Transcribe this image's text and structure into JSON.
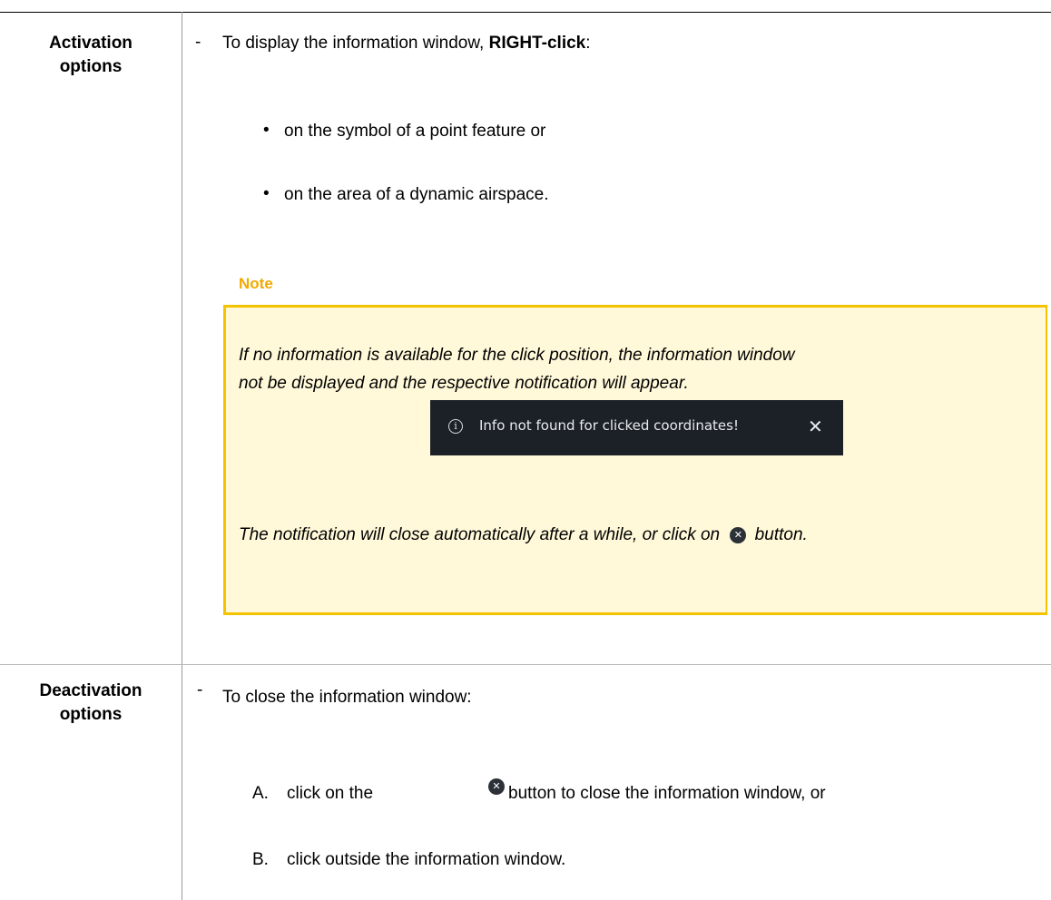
{
  "activation": {
    "term_line1": "Activation",
    "term_line2": "options",
    "dash": "-",
    "intro_prefix": "To display the information window, ",
    "intro_bold": "RIGHT-click",
    "intro_suffix": ":",
    "bullet_symbol": "•",
    "bullets": [
      "on the symbol of a point feature or",
      "on the area of a dynamic airspace."
    ],
    "note": {
      "title": "Note",
      "line1": "If no information is available for the click position, the information window",
      "line2": "not be displayed and the respective notification will appear.",
      "toast_info_icon": "i",
      "toast_message": "Info not found for clicked coordinates!",
      "toast_close": "✕",
      "closing_prefix": "The notification will close automatically after a while, or click on ",
      "closing_icon": "✕",
      "closing_suffix": " button."
    }
  },
  "deactivation": {
    "term_line1": "Deactivation",
    "term_line2": "options",
    "dash": "-",
    "intro": "To close the information window:",
    "item_a_marker": "A.",
    "item_a_prefix": "click on the",
    "item_a_icon": "✕",
    "item_a_suffix": "button to close the information window, or",
    "item_b_marker": "B.",
    "item_b_text": "click outside the information window."
  },
  "colors": {
    "note_title": "#f2a900",
    "note_border": "#f5c200",
    "note_background": "#fff9d9",
    "toast_background": "#1c2127"
  }
}
